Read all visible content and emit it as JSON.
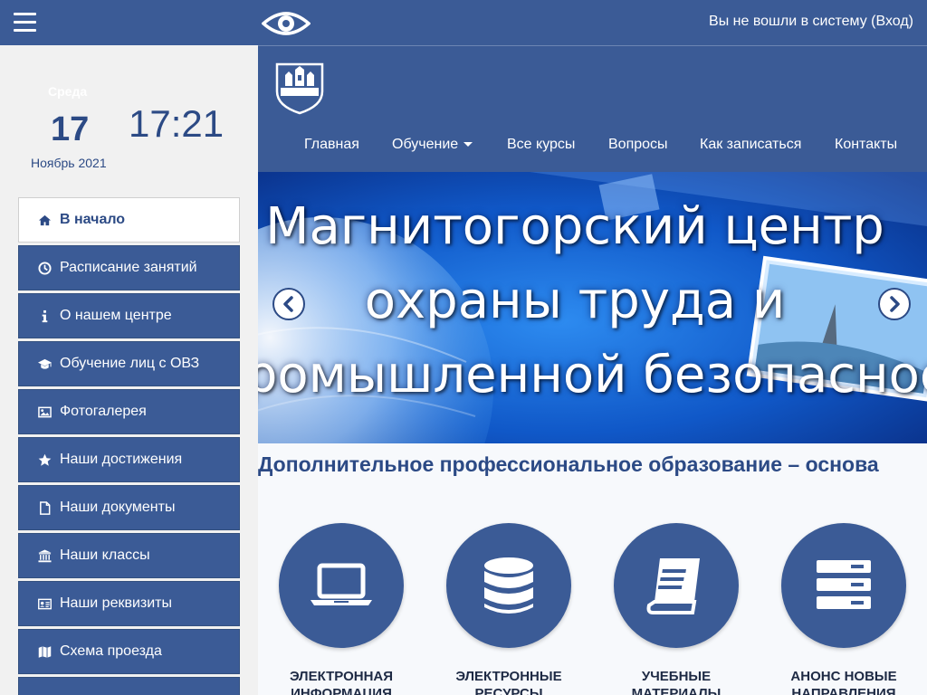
{
  "topbar": {
    "menu_icon": "hamburger-icon",
    "accessibility_icon": "eye-icon",
    "login_text": "Вы не вошли в систему (Вход)"
  },
  "sidebar": {
    "weekday": "Среда",
    "day": "17",
    "month_year": "Ноябрь 2021",
    "time": "17:21",
    "items": [
      {
        "label": "В начало",
        "icon": "home-icon",
        "active": true
      },
      {
        "label": "Расписание занятий",
        "icon": "clock-icon"
      },
      {
        "label": "О нашем центре",
        "icon": "info-icon"
      },
      {
        "label": "Обучение лиц с ОВЗ",
        "icon": "graduation-cap-icon"
      },
      {
        "label": "Фотогалерея",
        "icon": "image-icon"
      },
      {
        "label": "Наши достижения",
        "icon": "star-icon"
      },
      {
        "label": "Наши документы",
        "icon": "document-icon"
      },
      {
        "label": "Наши классы",
        "icon": "institution-icon"
      },
      {
        "label": "Наши реквизиты",
        "icon": "id-card-icon"
      },
      {
        "label": "Схема проезда",
        "icon": "map-icon"
      }
    ]
  },
  "header": {
    "logo_icon": "center-logo-icon",
    "nav": [
      {
        "label": "Главная"
      },
      {
        "label": "Обучение",
        "dropdown": true
      },
      {
        "label": "Все курсы"
      },
      {
        "label": "Вопросы"
      },
      {
        "label": "Как записаться"
      },
      {
        "label": "Контакты"
      }
    ]
  },
  "slider": {
    "lines": [
      "Магнитогорский центр",
      "охраны труда и",
      "промышленной безопасности"
    ],
    "prev_icon": "chevron-left-icon",
    "next_icon": "chevron-right-icon"
  },
  "content": {
    "tagline": "Дополнительное профессиональное образование – основа",
    "tiles": [
      {
        "label_line1": "ЭЛЕКТРОННАЯ",
        "label_line2": "ИНФОРМАЦИЯ",
        "icon": "laptop-icon"
      },
      {
        "label_line1": "ЭЛЕКТРОННЫЕ",
        "label_line2": "РЕСУРСЫ",
        "icon": "database-icon"
      },
      {
        "label_line1": "УЧЕБНЫЕ",
        "label_line2": "МАТЕРИАЛЫ",
        "icon": "book-icon"
      },
      {
        "label_line1": "АНОНС НОВЫЕ",
        "label_line2": "НАПРАВЛЕНИЯ",
        "icon": "server-icon"
      }
    ]
  },
  "colors": {
    "primary": "#3b5b96",
    "dark_text": "#2c4a85",
    "sidebar_bg": "#f1f1f1"
  }
}
